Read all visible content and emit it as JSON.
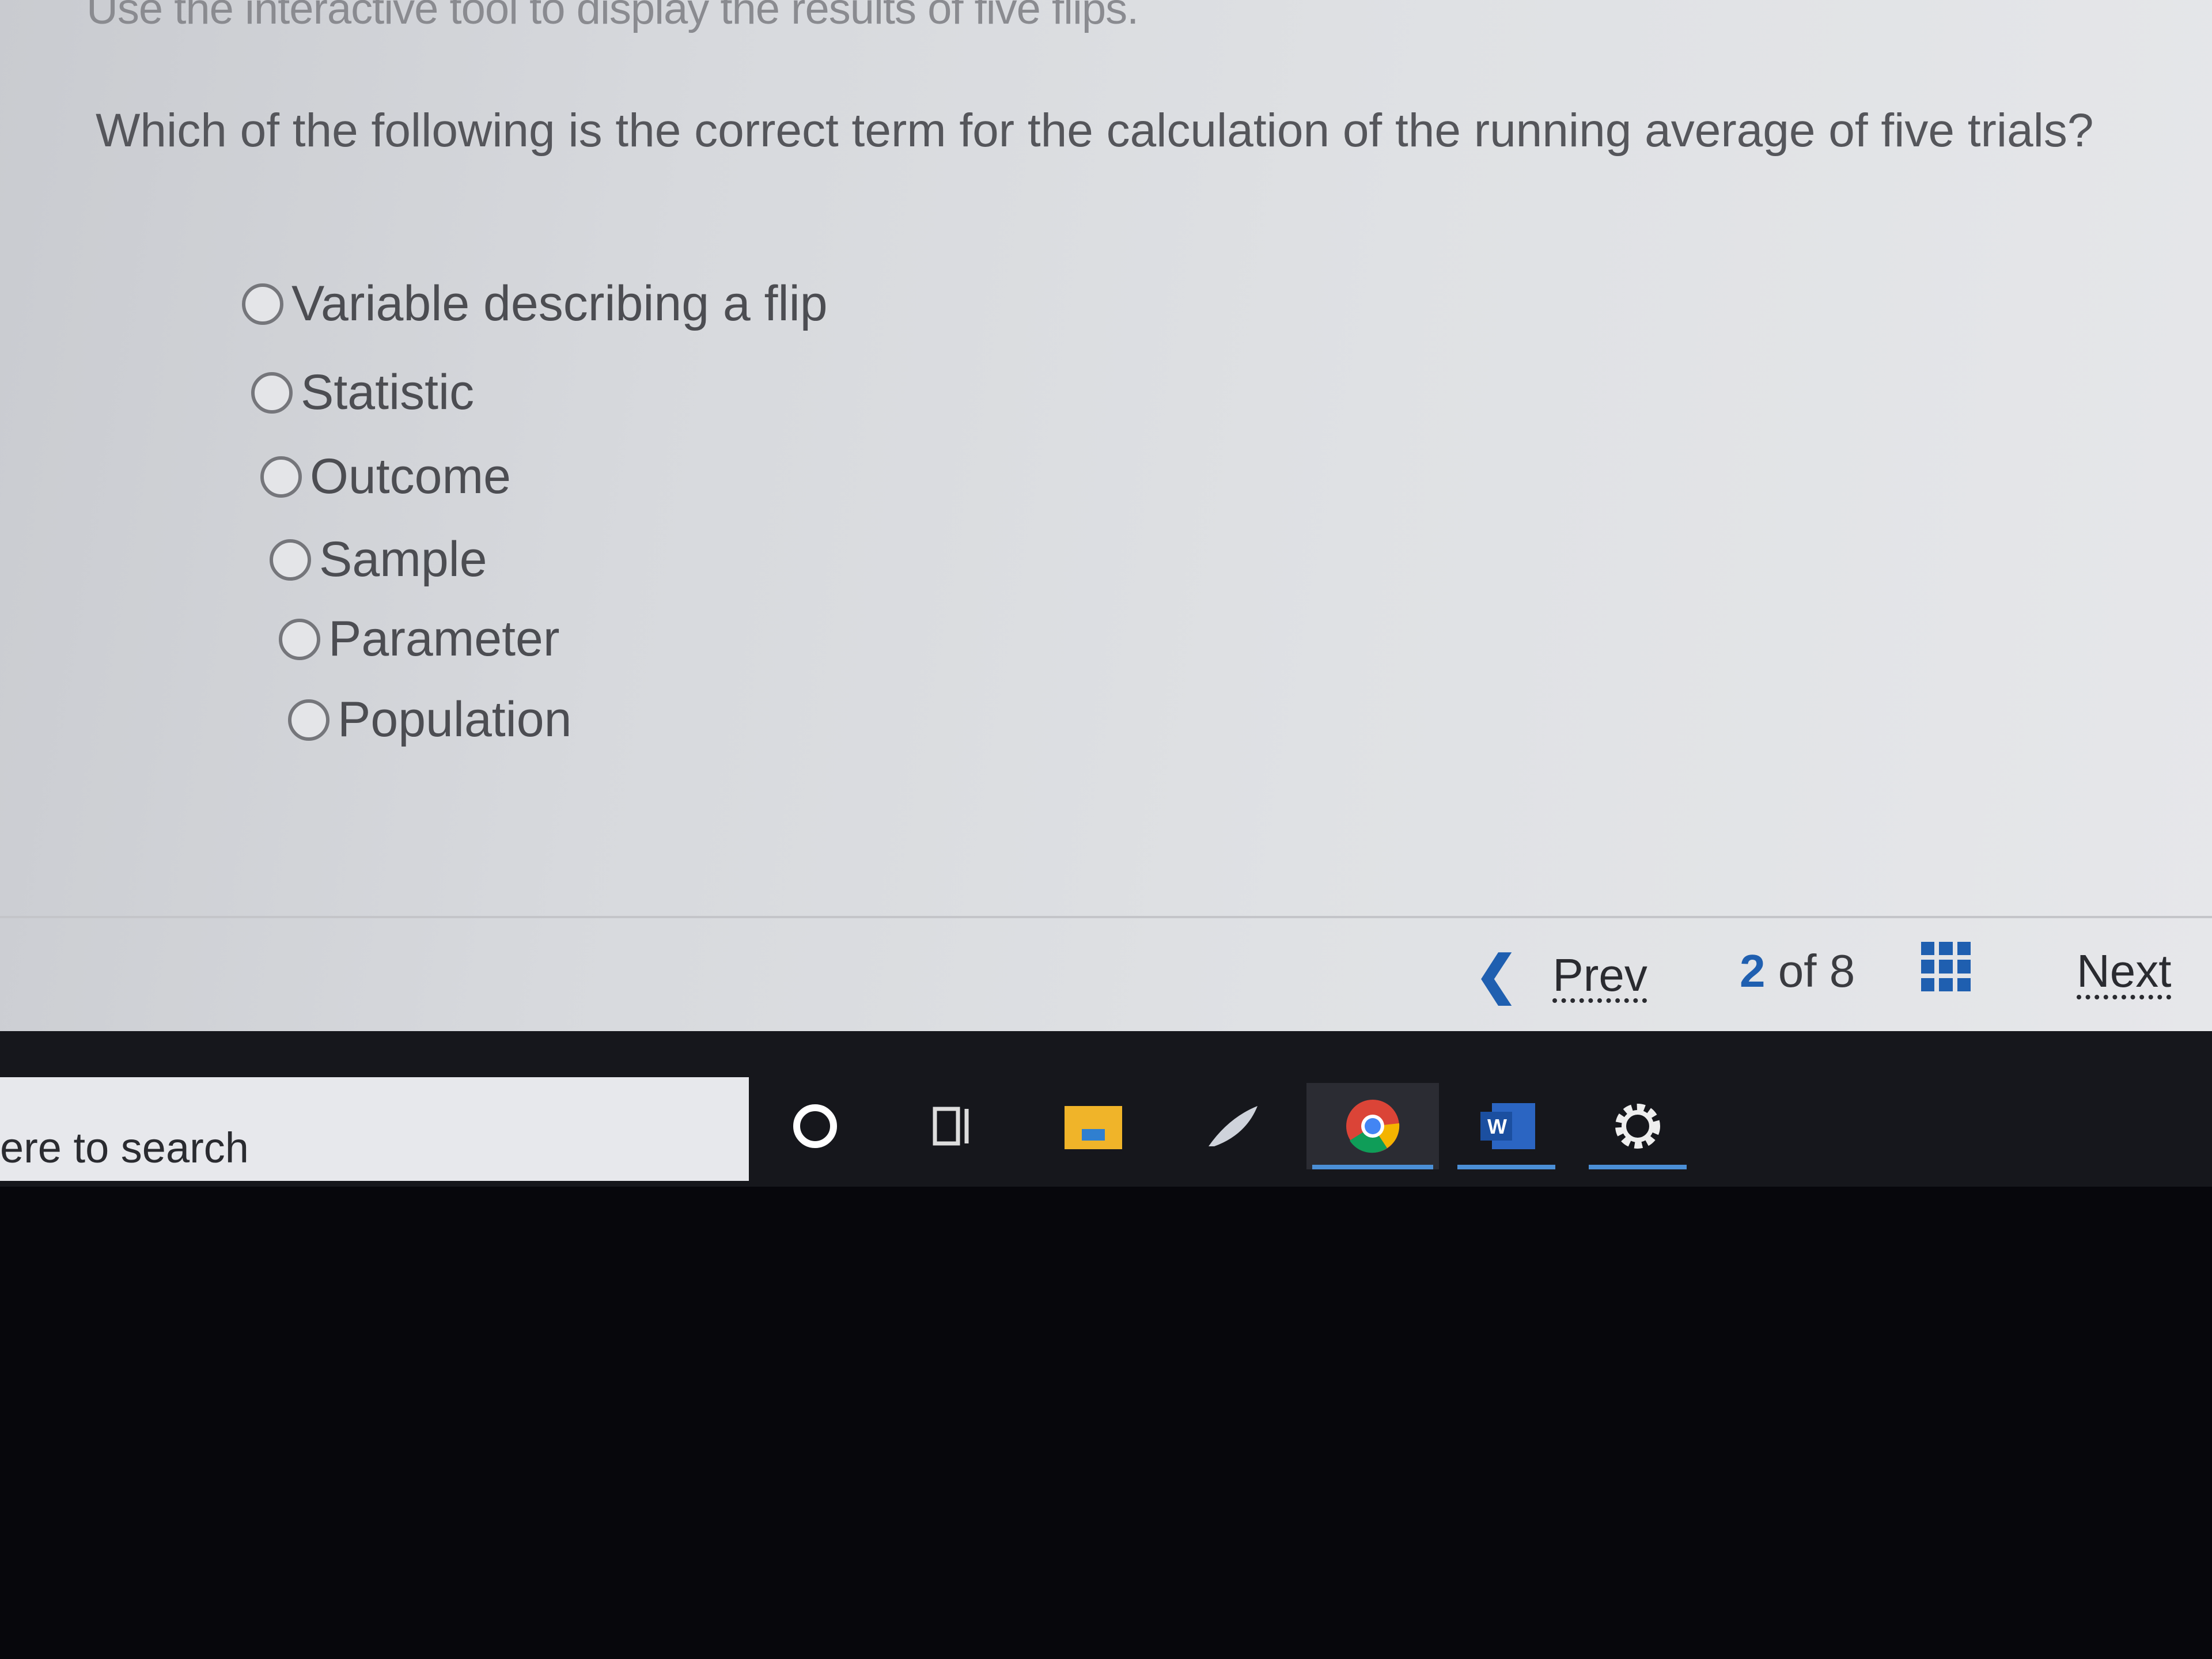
{
  "intro": "Use the interactive tool to display the results of five flips.",
  "question": "Which of the following is the correct term for the calculation of the running average of five trials?",
  "options": [
    "Variable describing a flip",
    "Statistic",
    "Outcome",
    "Sample",
    "Parameter",
    "Population"
  ],
  "nav": {
    "prev": "Prev",
    "current": "2",
    "of": "of",
    "total": "8",
    "next": "Next"
  },
  "taskbar": {
    "search_placeholder": "ere to search",
    "word_letter": "W",
    "icons": [
      "cortana-icon",
      "task-view-icon",
      "file-explorer-icon",
      "feather-app-icon",
      "chrome-icon",
      "word-icon",
      "settings-icon"
    ]
  },
  "colors": {
    "accent": "#1f5fb0",
    "taskbar": "#16171c"
  }
}
